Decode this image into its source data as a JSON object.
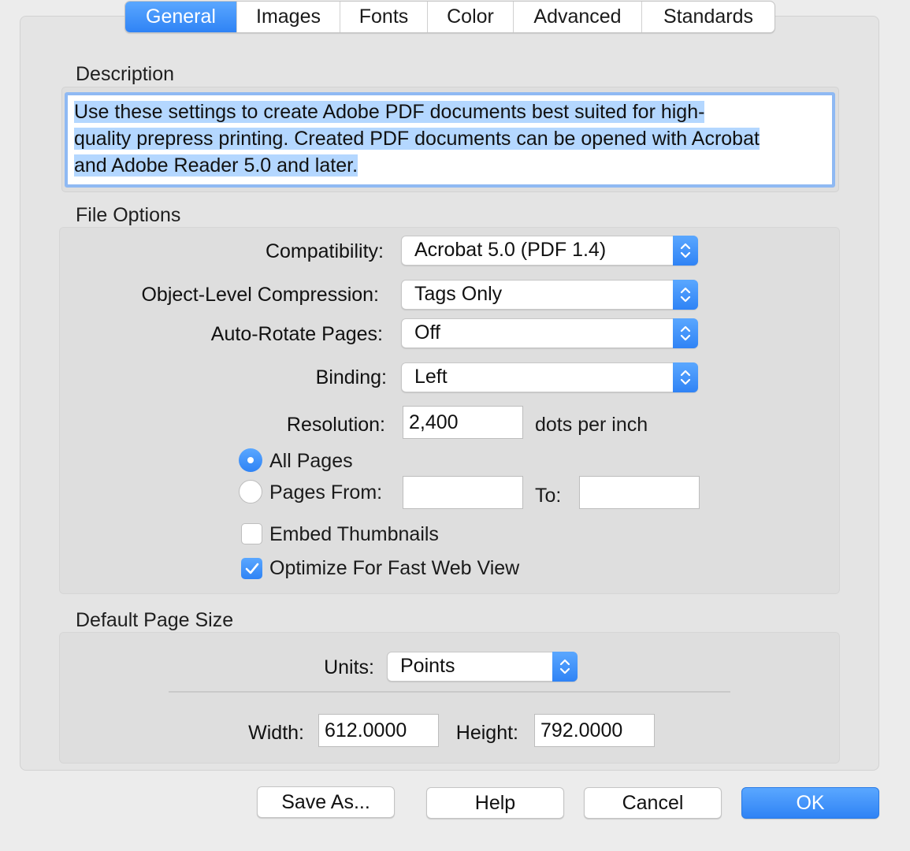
{
  "tabs": [
    {
      "label": "General",
      "active": true
    },
    {
      "label": "Images",
      "active": false
    },
    {
      "label": "Fonts",
      "active": false
    },
    {
      "label": "Color",
      "active": false
    },
    {
      "label": "Advanced",
      "active": false
    },
    {
      "label": "Standards",
      "active": false
    }
  ],
  "description": {
    "heading": "Description",
    "lines": [
      "Use these settings to create Adobe PDF documents best suited for high-",
      "quality prepress printing.  Created PDF documents can be opened with Acrobat",
      "and Adobe Reader 5.0 and later."
    ]
  },
  "file_options": {
    "heading": "File Options",
    "compatibility": {
      "label": "Compatibility:",
      "value": "Acrobat 5.0 (PDF 1.4)"
    },
    "compression": {
      "label": "Object-Level Compression:",
      "value": "Tags Only"
    },
    "auto_rotate": {
      "label": "Auto-Rotate Pages:",
      "value": "Off"
    },
    "binding": {
      "label": "Binding:",
      "value": "Left"
    },
    "resolution": {
      "label": "Resolution:",
      "value": "2,400",
      "unit": "dots per inch"
    },
    "all_pages": {
      "label": "All Pages",
      "selected": true
    },
    "pages_from": {
      "label": "Pages From:",
      "value": "",
      "to_label": "To:",
      "to_value": "",
      "selected": false
    },
    "embed_thumbnails": {
      "label": "Embed Thumbnails",
      "checked": false
    },
    "fast_web_view": {
      "label": "Optimize For Fast Web View",
      "checked": true
    }
  },
  "page_size": {
    "heading": "Default Page Size",
    "units": {
      "label": "Units:",
      "value": "Points"
    },
    "width": {
      "label": "Width:",
      "value": "612.0000"
    },
    "height": {
      "label": "Height:",
      "value": "792.0000"
    }
  },
  "buttons": {
    "save_as": "Save As...",
    "help": "Help",
    "cancel": "Cancel",
    "ok": "OK"
  },
  "colors": {
    "accent": "#3b8ff7",
    "selection": "#b4d7ff",
    "panel": "#ececec"
  }
}
